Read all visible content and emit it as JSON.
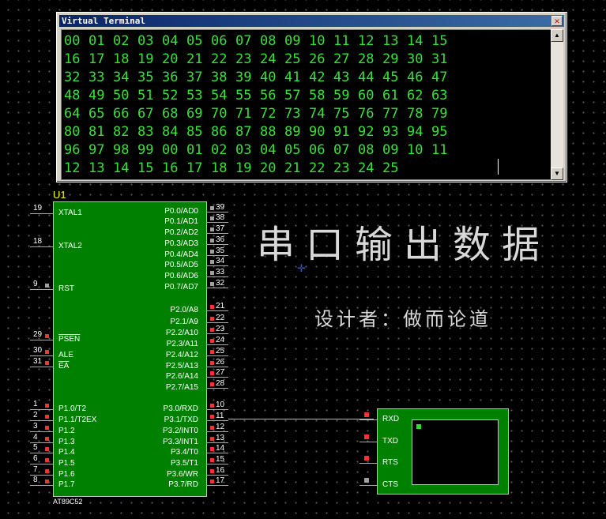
{
  "terminal": {
    "title": "Virtual Terminal",
    "close_glyph": "✕",
    "rows": [
      [
        "00",
        "01",
        "02",
        "03",
        "04",
        "05",
        "06",
        "07",
        "08",
        "09",
        "10",
        "11",
        "12",
        "13",
        "14",
        "15"
      ],
      [
        "16",
        "17",
        "18",
        "19",
        "20",
        "21",
        "22",
        "23",
        "24",
        "25",
        "26",
        "27",
        "28",
        "29",
        "30",
        "31"
      ],
      [
        "32",
        "33",
        "34",
        "35",
        "36",
        "37",
        "38",
        "39",
        "40",
        "41",
        "42",
        "43",
        "44",
        "45",
        "46",
        "47"
      ],
      [
        "48",
        "49",
        "50",
        "51",
        "52",
        "53",
        "54",
        "55",
        "56",
        "57",
        "58",
        "59",
        "60",
        "61",
        "62",
        "63"
      ],
      [
        "64",
        "65",
        "66",
        "67",
        "68",
        "69",
        "70",
        "71",
        "72",
        "73",
        "74",
        "75",
        "76",
        "77",
        "78",
        "79"
      ],
      [
        "80",
        "81",
        "82",
        "83",
        "84",
        "85",
        "86",
        "87",
        "88",
        "89",
        "90",
        "91",
        "92",
        "93",
        "94",
        "95"
      ],
      [
        "96",
        "97",
        "98",
        "99",
        "00",
        "01",
        "02",
        "03",
        "04",
        "05",
        "06",
        "07",
        "08",
        "09",
        "10",
        "11"
      ],
      [
        "12",
        "13",
        "14",
        "15",
        "16",
        "17",
        "18",
        "19",
        "20",
        "21",
        "22",
        "23",
        "24",
        "25"
      ]
    ],
    "text_color": "#37e137"
  },
  "chip": {
    "ref": "U1",
    "model": "AT89C52",
    "left_pins": [
      {
        "num": "19",
        "label": "XTAL1"
      },
      {
        "num": "18",
        "label": "XTAL2"
      },
      {
        "num": "9",
        "label": "RST"
      },
      {
        "num": "29",
        "label": "PSEN"
      },
      {
        "num": "30",
        "label": "ALE"
      },
      {
        "num": "31",
        "label": "EA"
      },
      {
        "num": "1",
        "label": "P1.0/T2"
      },
      {
        "num": "2",
        "label": "P1.1/T2EX"
      },
      {
        "num": "3",
        "label": "P1.2"
      },
      {
        "num": "4",
        "label": "P1.3"
      },
      {
        "num": "5",
        "label": "P1.4"
      },
      {
        "num": "6",
        "label": "P1.5"
      },
      {
        "num": "7",
        "label": "P1.6"
      },
      {
        "num": "8",
        "label": "P1.7"
      }
    ],
    "right_pins": [
      {
        "num": "39",
        "label": "P0.0/AD0"
      },
      {
        "num": "38",
        "label": "P0.1/AD1"
      },
      {
        "num": "37",
        "label": "P0.2/AD2"
      },
      {
        "num": "36",
        "label": "P0.3/AD3"
      },
      {
        "num": "35",
        "label": "P0.4/AD4"
      },
      {
        "num": "34",
        "label": "P0.5/AD5"
      },
      {
        "num": "33",
        "label": "P0.6/AD6"
      },
      {
        "num": "32",
        "label": "P0.7/AD7"
      },
      {
        "num": "21",
        "label": "P2.0/A8"
      },
      {
        "num": "22",
        "label": "P2.1/A9"
      },
      {
        "num": "23",
        "label": "P2.2/A10"
      },
      {
        "num": "24",
        "label": "P2.3/A11"
      },
      {
        "num": "25",
        "label": "P2.4/A12"
      },
      {
        "num": "26",
        "label": "P2.5/A13"
      },
      {
        "num": "27",
        "label": "P2.6/A14"
      },
      {
        "num": "28",
        "label": "P2.7/A15"
      },
      {
        "num": "10",
        "label": "P3.0/RXD"
      },
      {
        "num": "11",
        "label": "P3.1/TXD"
      },
      {
        "num": "12",
        "label": "P3.2/INT0"
      },
      {
        "num": "13",
        "label": "P3.3/INT1"
      },
      {
        "num": "14",
        "label": "P3.4/T0"
      },
      {
        "num": "15",
        "label": "P3.5/T1"
      },
      {
        "num": "16",
        "label": "P3.6/WR"
      },
      {
        "num": "17",
        "label": "P3.7/RD"
      }
    ]
  },
  "device": {
    "pins": [
      "RXD",
      "TXD",
      "RTS",
      "CTS"
    ]
  },
  "annotations": {
    "headline": "串口输出数据",
    "author": "设计者：做而论道"
  },
  "colors": {
    "chip_fill": "#008000",
    "pin_red": "#ff3030",
    "pin_gray": "#a0a0a0",
    "chip_ref": "#ffff00"
  }
}
